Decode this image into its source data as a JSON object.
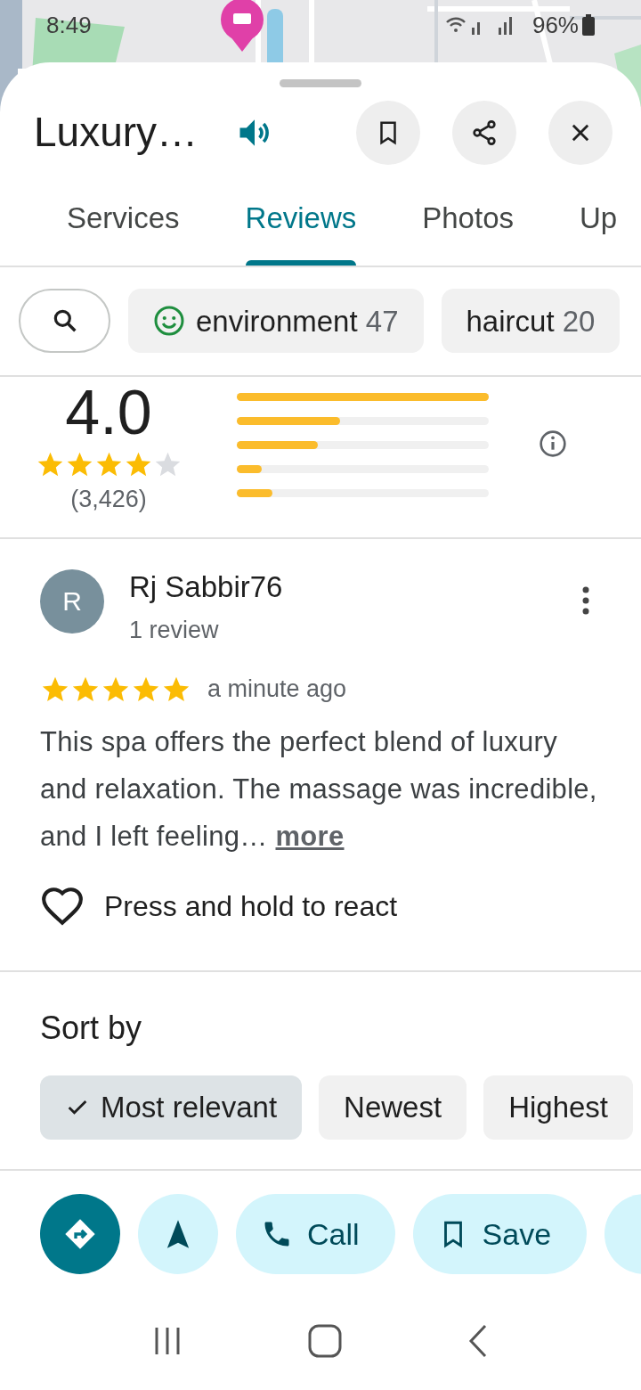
{
  "status_bar": {
    "time": "8:49",
    "battery": "96%"
  },
  "place": {
    "title": "Luxury…"
  },
  "tabs": [
    {
      "label": "Services",
      "selected": false
    },
    {
      "label": "Reviews",
      "selected": true
    },
    {
      "label": "Photos",
      "selected": false
    },
    {
      "label": "Up",
      "selected": false
    }
  ],
  "topic_chips": [
    {
      "label": "environment",
      "count": "47",
      "kind": "sentiment"
    },
    {
      "label": "haircut",
      "count": "20",
      "kind": "plain"
    }
  ],
  "rating": {
    "score": "4.0",
    "stars": 4,
    "count": "(3,426)",
    "bars": [
      {
        "level": 1.0
      },
      {
        "level": 0.41
      },
      {
        "level": 0.32
      },
      {
        "level": 0.1
      },
      {
        "level": 0.14
      }
    ]
  },
  "review": {
    "initial": "R",
    "author": "Rj Sabbir76",
    "meta": "1 review",
    "stars": 5,
    "time": "a minute ago",
    "text": "This spa offers the perfect blend of luxury and relaxation. The massage was incredible, and I left feeling…",
    "more": "more",
    "react": "Press and hold to react"
  },
  "sort": {
    "title": "Sort by",
    "options": [
      {
        "label": "Most relevant",
        "selected": true
      },
      {
        "label": "Newest",
        "selected": false
      },
      {
        "label": "Highest",
        "selected": false
      }
    ]
  },
  "actions": [
    {
      "kind": "directions"
    },
    {
      "kind": "start"
    },
    {
      "kind": "call",
      "label": "Call"
    },
    {
      "kind": "save",
      "label": "Save"
    },
    {
      "kind": "more"
    }
  ]
}
